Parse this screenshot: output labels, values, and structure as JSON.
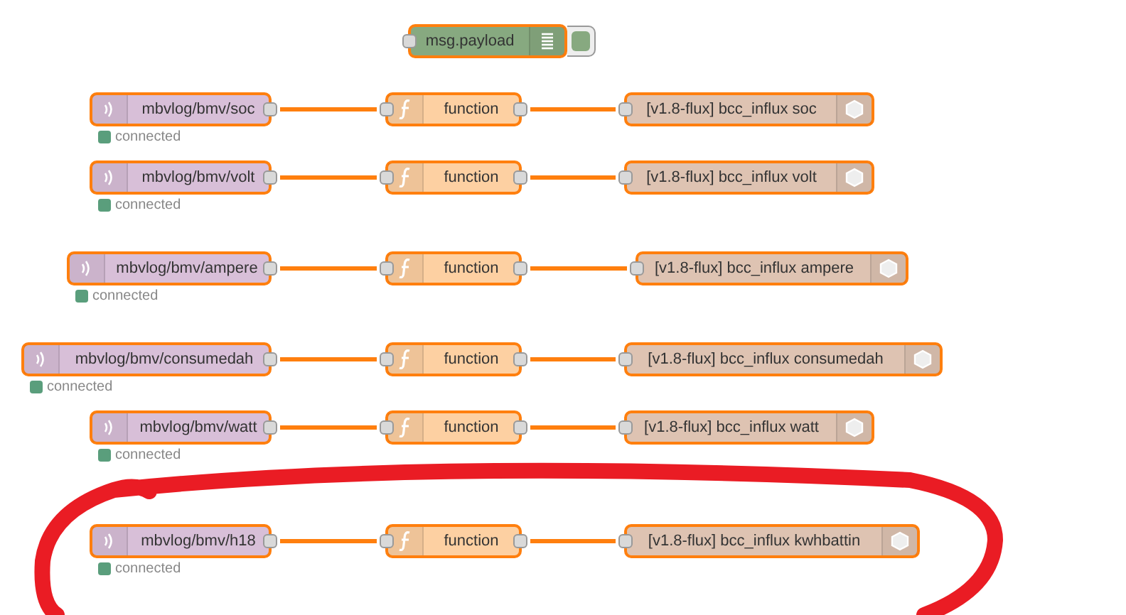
{
  "debug_node": {
    "label": "msg.payload",
    "active": true
  },
  "flows": [
    {
      "input": {
        "topic": "mbvlog/bmv/soc",
        "status": "connected"
      },
      "function": {
        "label": "function"
      },
      "output": {
        "label": "[v1.8-flux] bcc_influx soc"
      }
    },
    {
      "input": {
        "topic": "mbvlog/bmv/volt",
        "status": "connected"
      },
      "function": {
        "label": "function"
      },
      "output": {
        "label": "[v1.8-flux] bcc_influx volt"
      }
    },
    {
      "input": {
        "topic": "mbvlog/bmv/ampere",
        "status": "connected"
      },
      "function": {
        "label": "function"
      },
      "output": {
        "label": "[v1.8-flux] bcc_influx ampere"
      }
    },
    {
      "input": {
        "topic": "mbvlog/bmv/consumedah",
        "status": "connected"
      },
      "function": {
        "label": "function"
      },
      "output": {
        "label": "[v1.8-flux] bcc_influx consumedah"
      }
    },
    {
      "input": {
        "topic": "mbvlog/bmv/watt",
        "status": "connected"
      },
      "function": {
        "label": "function"
      },
      "output": {
        "label": "[v1.8-flux] bcc_influx watt"
      }
    },
    {
      "input": {
        "topic": "mbvlog/bmv/h18",
        "status": "connected"
      },
      "function": {
        "label": "function"
      },
      "output": {
        "label": "[v1.8-flux] bcc_influx kwhbattin"
      }
    }
  ]
}
